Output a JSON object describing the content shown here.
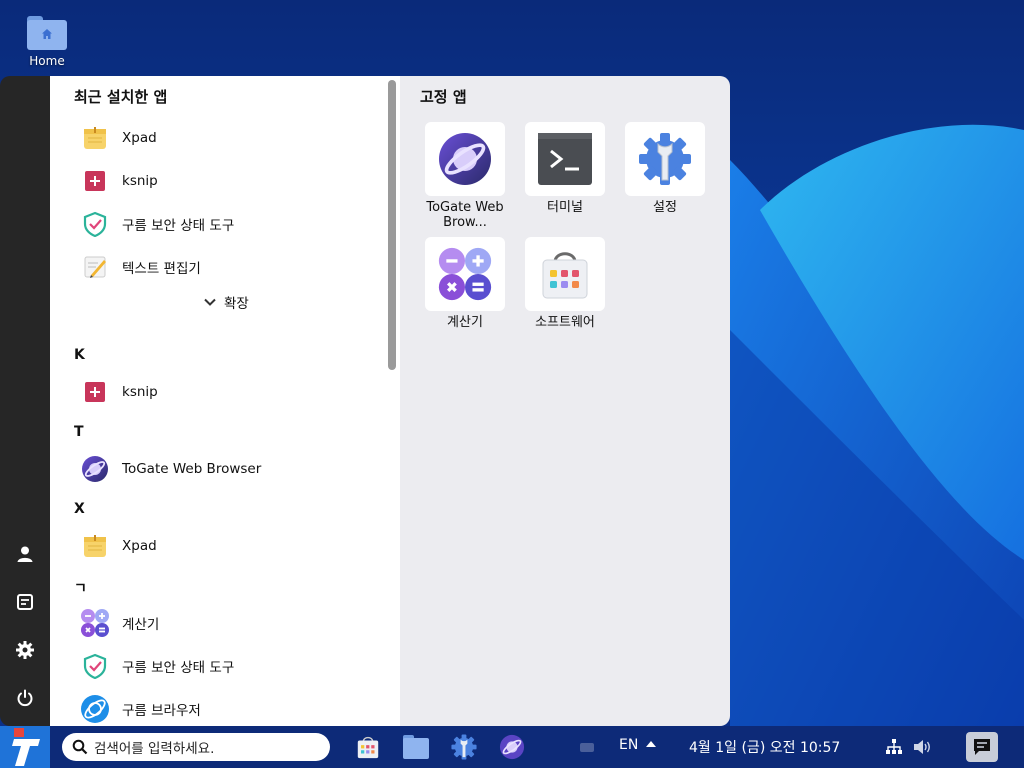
{
  "desktop": {
    "home_icon_label": "Home"
  },
  "menu": {
    "recent_title": "최근 설치한 앱",
    "recent_apps": [
      {
        "label": "Xpad",
        "icon": "xpad-icon"
      },
      {
        "label": "ksnip",
        "icon": "ksnip-icon"
      },
      {
        "label": "구름 보안 상태 도구",
        "icon": "security-shield-icon"
      },
      {
        "label": "텍스트 편집기",
        "icon": "text-editor-icon"
      }
    ],
    "expand_label": "확장",
    "sections": [
      {
        "letter": "K",
        "apps": [
          {
            "label": "ksnip"
          }
        ]
      },
      {
        "letter": "T",
        "apps": [
          {
            "label": "ToGate Web Browser"
          }
        ]
      },
      {
        "letter": "X",
        "apps": [
          {
            "label": "Xpad"
          }
        ]
      },
      {
        "letter": "ㄱ",
        "apps": [
          {
            "label": "계산기"
          },
          {
            "label": "구름 보안 상태 도구"
          },
          {
            "label": "구름 브라우저"
          }
        ]
      }
    ],
    "pinned_title": "고정 앱",
    "pinned_apps": [
      {
        "label": "ToGate Web Brow...",
        "icon": "togate-browser-icon"
      },
      {
        "label": "터미널",
        "icon": "terminal-icon"
      },
      {
        "label": "설정",
        "icon": "settings-icon"
      },
      {
        "label": "계산기",
        "icon": "calculator-icon"
      },
      {
        "label": "소프트웨어",
        "icon": "software-store-icon"
      }
    ],
    "rail": [
      "user-icon",
      "documents-icon",
      "gear-icon",
      "power-icon"
    ]
  },
  "taskbar": {
    "search_placeholder": "검색어를 입력하세요.",
    "apps": [
      "software-store-icon",
      "files-icon",
      "settings-icon",
      "togate-browser-icon"
    ],
    "input_language": "EN",
    "datetime": "4월 1일 (금) 오전 10:57"
  },
  "colors": {
    "rail": "#262626",
    "accent": "#1f73d8",
    "taskbar": "#0d2a78"
  }
}
